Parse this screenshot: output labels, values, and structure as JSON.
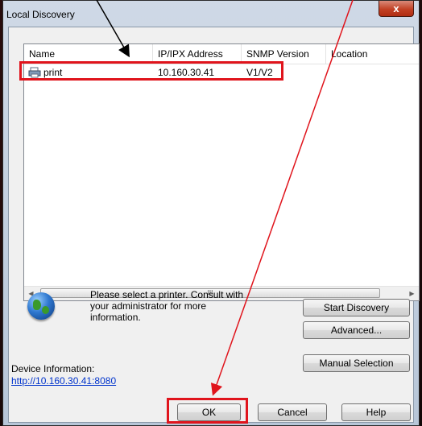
{
  "window": {
    "title": "Local Discovery",
    "close_label": "x"
  },
  "listview": {
    "columns": [
      "Name",
      "IP/IPX Address",
      "SNMP Version",
      "Location"
    ],
    "rows": [
      {
        "name": "print",
        "ip": "10.160.30.41",
        "snmp": "V1/V2",
        "location": ""
      }
    ],
    "scroll_thumb": "III"
  },
  "message": "Please select a printer. Consult with your administrator for more information.",
  "buttons": {
    "start_discovery": "Start Discovery",
    "advanced": "Advanced...",
    "manual_selection": "Manual Selection",
    "ok": "OK",
    "cancel": "Cancel",
    "help": "Help"
  },
  "device_info": {
    "label": "Device Information:",
    "link": "http://10.160.30.41:8080"
  },
  "colors": {
    "highlight": "#e0141c",
    "link": "#0033cc"
  }
}
